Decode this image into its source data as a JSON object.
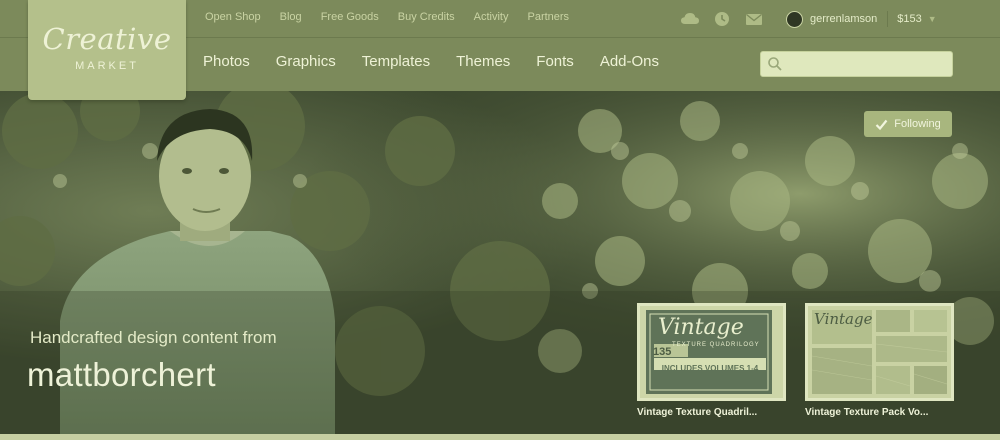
{
  "brand": {
    "logo_script": "Creative",
    "logo_sub": "MARKET"
  },
  "top_nav": [
    "Open Shop",
    "Blog",
    "Free Goods",
    "Buy Credits",
    "Activity",
    "Partners"
  ],
  "top_icons": [
    "cloud-icon",
    "clock-icon",
    "mail-icon"
  ],
  "user": {
    "name": "gerrenlamson",
    "credit": "$153"
  },
  "main_nav": [
    "Photos",
    "Graphics",
    "Templates",
    "Themes",
    "Fonts",
    "Add-Ons"
  ],
  "search": {
    "placeholder": "",
    "value": ""
  },
  "hero": {
    "follow_label": "Following",
    "tagline": "Handcrafted design content from",
    "shop_name": "mattborchert"
  },
  "products": [
    {
      "title": "Vintage Texture Quadril...",
      "thumb_heading": "Vintage",
      "thumb_sub": "TEXTURE QUADRILOGY",
      "thumb_count": "135",
      "thumb_caption": "INCLUDES VOLUMES 1-4"
    },
    {
      "title": "Vintage Texture Pack Vo...",
      "thumb_heading": "Vintage"
    }
  ],
  "colors": {
    "header_bg": "#7c8a5b",
    "logo_bg": "#b4c08b",
    "button_bg": "#a8b67e",
    "search_bg": "#dfe8bd"
  }
}
